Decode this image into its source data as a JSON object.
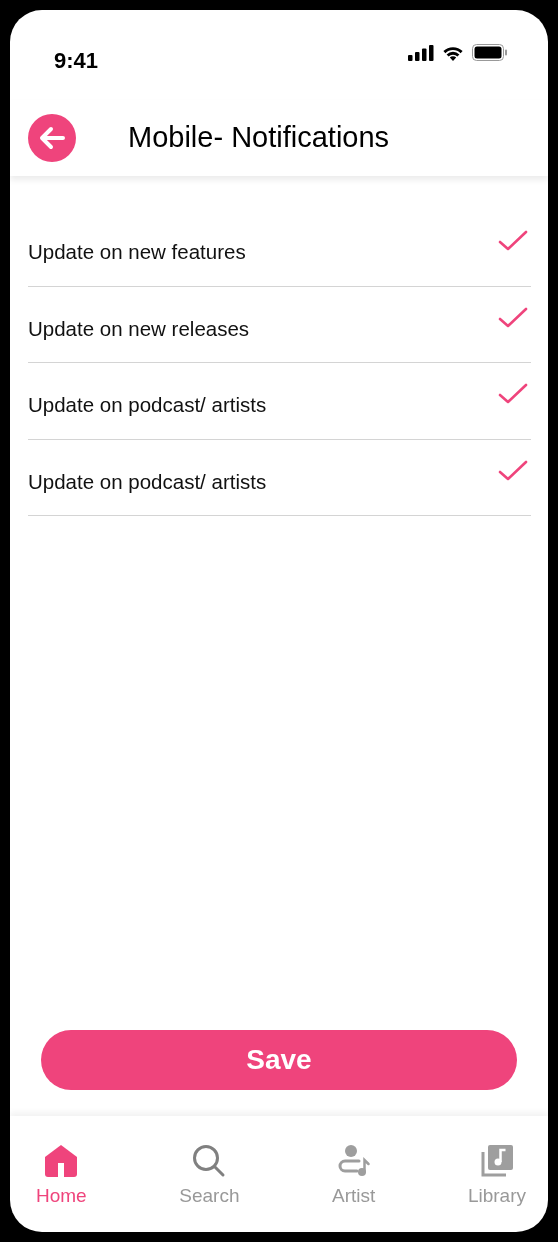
{
  "status_bar": {
    "time": "9:41"
  },
  "header": {
    "title": "Mobile- Notifications"
  },
  "options": [
    {
      "label": "Update on new features",
      "checked": true
    },
    {
      "label": "Update on new releases",
      "checked": true
    },
    {
      "label": "Update on podcast/ artists",
      "checked": true
    },
    {
      "label": "Update on podcast/ artists",
      "checked": true
    }
  ],
  "save_button": "Save",
  "tabs": [
    {
      "kind": "home",
      "label": "Home",
      "selected": true
    },
    {
      "kind": "search",
      "label": "Search",
      "selected": false
    },
    {
      "kind": "artist",
      "label": "Artist",
      "selected": false
    },
    {
      "kind": "library",
      "label": "Library",
      "selected": false
    }
  ]
}
